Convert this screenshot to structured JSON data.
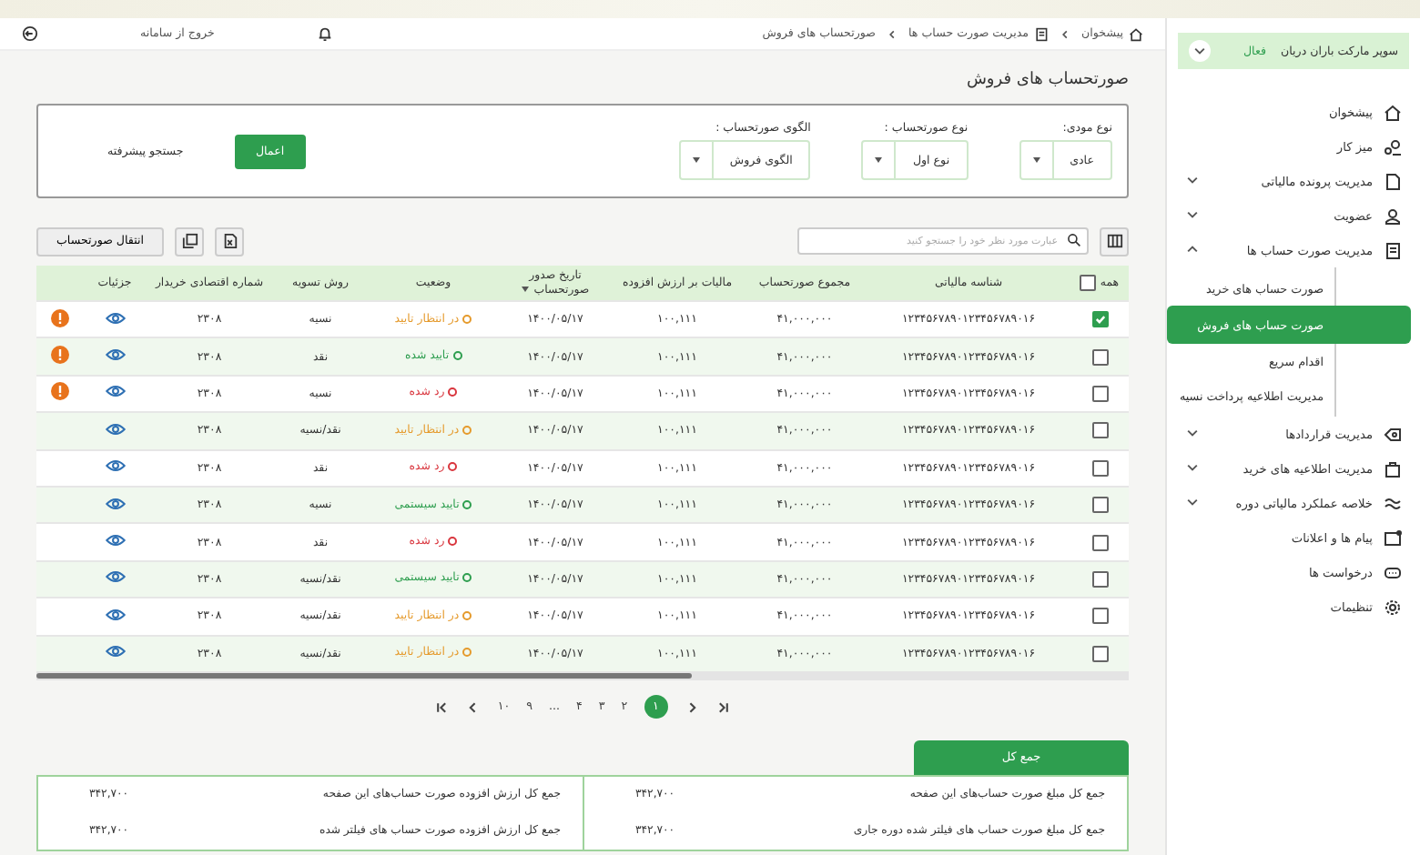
{
  "sidebar": {
    "company": {
      "name": "سوپر مارکت باران دریان",
      "status": "فعال"
    },
    "items": [
      {
        "label": "پیشخوان",
        "selected": false
      },
      {
        "label": "میز کار",
        "selected": false
      },
      {
        "label": "مدیریت پرونده مالیاتی",
        "selected": false,
        "expanded": false
      },
      {
        "label": "عضویت",
        "selected": false,
        "expanded": false
      },
      {
        "label": "مدیریت صورت حساب ها",
        "selected": false,
        "expanded": true,
        "children": [
          {
            "label": "صورت حساب های خرید",
            "selected": false
          },
          {
            "label": "صورت حساب های فروش",
            "selected": true
          },
          {
            "label": "اقدام سریع",
            "selected": false
          },
          {
            "label": "مدیریت اطلاعیه پرداخت نسیه",
            "selected": false
          }
        ]
      },
      {
        "label": "مدیریت قراردادها",
        "selected": false,
        "expanded": false
      },
      {
        "label": "مدیریت اطلاعیه های خرید",
        "selected": false,
        "expanded": false
      },
      {
        "label": "خلاصه عملکرد مالیاتی دوره",
        "selected": false,
        "expanded": false
      },
      {
        "label": "پیام ها و اعلانات",
        "selected": false
      },
      {
        "label": "درخواست ها",
        "selected": false
      },
      {
        "label": "تنظیمات",
        "selected": false
      }
    ]
  },
  "header": {
    "breadcrumb": [
      "پیشخوان",
      "مدیریت صورت حساب ها",
      "صورتحساب های فروش"
    ],
    "logout": "خروج از سامانه"
  },
  "page_title": "صورتحساب های فروش",
  "filters": {
    "fields": [
      {
        "label": "نوع مودی:",
        "value": "عادی"
      },
      {
        "label": "نوع صورتحساب :",
        "value": "نوع اول"
      },
      {
        "label": "الگوی صورتحساب :",
        "value": "الگوی فروش"
      }
    ],
    "apply": "اعمال",
    "advanced_search": "جستجو پیشرفته"
  },
  "toolbar": {
    "search": {
      "placeholder": "عبارت مورد نظر خود را جستجو کنید"
    },
    "transfer": "انتقال صورتحساب"
  },
  "table": {
    "select_all": {
      "label": "همه",
      "checked": false
    },
    "columns": [
      "شناسه مالیاتی",
      "مجموع صورتحساب",
      "مالیات بر ارزش افزوده",
      "تاریخ صدور صورتحساب",
      "وضعیت",
      "روش تسویه",
      "شماره اقتصادی خریدار",
      "جزئیات"
    ],
    "rows": [
      {
        "checked": true,
        "id": "۱۲۳۴۵۶۷۸۹۰۱۲۳۴۵۶۷۸۹۰۱۶",
        "total": "۴۱,۰۰۰,۰۰۰",
        "vat": "۱۰۰,۱۱۱",
        "date": "۱۴۰۰/۰۵/۱۷",
        "status": {
          "text": "در انتظار تایید",
          "kind": "pending"
        },
        "settlement": "نسیه",
        "buyer": "۲۳۰۸",
        "warning": true
      },
      {
        "checked": false,
        "id": "۱۲۳۴۵۶۷۸۹۰۱۲۳۴۵۶۷۸۹۰۱۶",
        "total": "۴۱,۰۰۰,۰۰۰",
        "vat": "۱۰۰,۱۱۱",
        "date": "۱۴۰۰/۰۵/۱۷",
        "status": {
          "text": "تایید شده",
          "kind": "approved"
        },
        "settlement": "نقد",
        "buyer": "۲۳۰۸",
        "warning": true
      },
      {
        "checked": false,
        "id": "۱۲۳۴۵۶۷۸۹۰۱۲۳۴۵۶۷۸۹۰۱۶",
        "total": "۴۱,۰۰۰,۰۰۰",
        "vat": "۱۰۰,۱۱۱",
        "date": "۱۴۰۰/۰۵/۱۷",
        "status": {
          "text": "رد شده",
          "kind": "rejected"
        },
        "settlement": "نسیه",
        "buyer": "۲۳۰۸",
        "warning": true
      },
      {
        "checked": false,
        "id": "۱۲۳۴۵۶۷۸۹۰۱۲۳۴۵۶۷۸۹۰۱۶",
        "total": "۴۱,۰۰۰,۰۰۰",
        "vat": "۱۰۰,۱۱۱",
        "date": "۱۴۰۰/۰۵/۱۷",
        "status": {
          "text": "در انتظار تایید",
          "kind": "pending"
        },
        "settlement": "نقد/نسیه",
        "buyer": "۲۳۰۸",
        "warning": false
      },
      {
        "checked": false,
        "id": "۱۲۳۴۵۶۷۸۹۰۱۲۳۴۵۶۷۸۹۰۱۶",
        "total": "۴۱,۰۰۰,۰۰۰",
        "vat": "۱۰۰,۱۱۱",
        "date": "۱۴۰۰/۰۵/۱۷",
        "status": {
          "text": "رد شده",
          "kind": "rejected"
        },
        "settlement": "نقد",
        "buyer": "۲۳۰۸",
        "warning": false
      },
      {
        "checked": false,
        "id": "۱۲۳۴۵۶۷۸۹۰۱۲۳۴۵۶۷۸۹۰۱۶",
        "total": "۴۱,۰۰۰,۰۰۰",
        "vat": "۱۰۰,۱۱۱",
        "date": "۱۴۰۰/۰۵/۱۷",
        "status": {
          "text": "تایید سیستمی",
          "kind": "system"
        },
        "settlement": "نسیه",
        "buyer": "۲۳۰۸",
        "warning": false
      },
      {
        "checked": false,
        "id": "۱۲۳۴۵۶۷۸۹۰۱۲۳۴۵۶۷۸۹۰۱۶",
        "total": "۴۱,۰۰۰,۰۰۰",
        "vat": "۱۰۰,۱۱۱",
        "date": "۱۴۰۰/۰۵/۱۷",
        "status": {
          "text": "رد شده",
          "kind": "rejected"
        },
        "settlement": "نقد",
        "buyer": "۲۳۰۸",
        "warning": false
      },
      {
        "checked": false,
        "id": "۱۲۳۴۵۶۷۸۹۰۱۲۳۴۵۶۷۸۹۰۱۶",
        "total": "۴۱,۰۰۰,۰۰۰",
        "vat": "۱۰۰,۱۱۱",
        "date": "۱۴۰۰/۰۵/۱۷",
        "status": {
          "text": "تایید سیستمی",
          "kind": "system"
        },
        "settlement": "نقد/نسیه",
        "buyer": "۲۳۰۸",
        "warning": false
      },
      {
        "checked": false,
        "id": "۱۲۳۴۵۶۷۸۹۰۱۲۳۴۵۶۷۸۹۰۱۶",
        "total": "۴۱,۰۰۰,۰۰۰",
        "vat": "۱۰۰,۱۱۱",
        "date": "۱۴۰۰/۰۵/۱۷",
        "status": {
          "text": "در انتظار تایید",
          "kind": "pending"
        },
        "settlement": "نقد/نسیه",
        "buyer": "۲۳۰۸",
        "warning": false
      },
      {
        "checked": false,
        "id": "۱۲۳۴۵۶۷۸۹۰۱۲۳۴۵۶۷۸۹۰۱۶",
        "total": "۴۱,۰۰۰,۰۰۰",
        "vat": "۱۰۰,۱۱۱",
        "date": "۱۴۰۰/۰۵/۱۷",
        "status": {
          "text": "در انتظار تایید",
          "kind": "pending"
        },
        "settlement": "نقد/نسیه",
        "buyer": "۲۳۰۸",
        "warning": false
      }
    ]
  },
  "pagination": [
    {
      "kind": "first"
    },
    {
      "kind": "prev"
    },
    {
      "kind": "page",
      "label": "۱",
      "selected": true
    },
    {
      "kind": "page",
      "label": "۲",
      "selected": false
    },
    {
      "kind": "page",
      "label": "۳",
      "selected": false
    },
    {
      "kind": "page",
      "label": "۴",
      "selected": false
    },
    {
      "kind": "gap",
      "label": "..."
    },
    {
      "kind": "page",
      "label": "۹",
      "selected": false
    },
    {
      "kind": "page",
      "label": "۱۰",
      "selected": false
    },
    {
      "kind": "next"
    },
    {
      "kind": "last"
    }
  ],
  "totals": {
    "tab": "جمع کل",
    "items": [
      {
        "label": "جمع کل مبلغ صورت حساب‌های این صفحه",
        "value": "۳۴۲,۷۰۰"
      },
      {
        "label": "جمع کل ارزش افزوده صورت حساب‌های این صفحه",
        "value": "۳۴۲,۷۰۰"
      },
      {
        "label": "جمع کل مبلغ صورت حساب های فیلتر شده دوره جاری",
        "value": "۳۴۲,۷۰۰"
      },
      {
        "label": "جمع کل ارزش افزوده صورت حساب های فیلتر شده",
        "value": "۳۴۲,۷۰۰"
      }
    ]
  }
}
